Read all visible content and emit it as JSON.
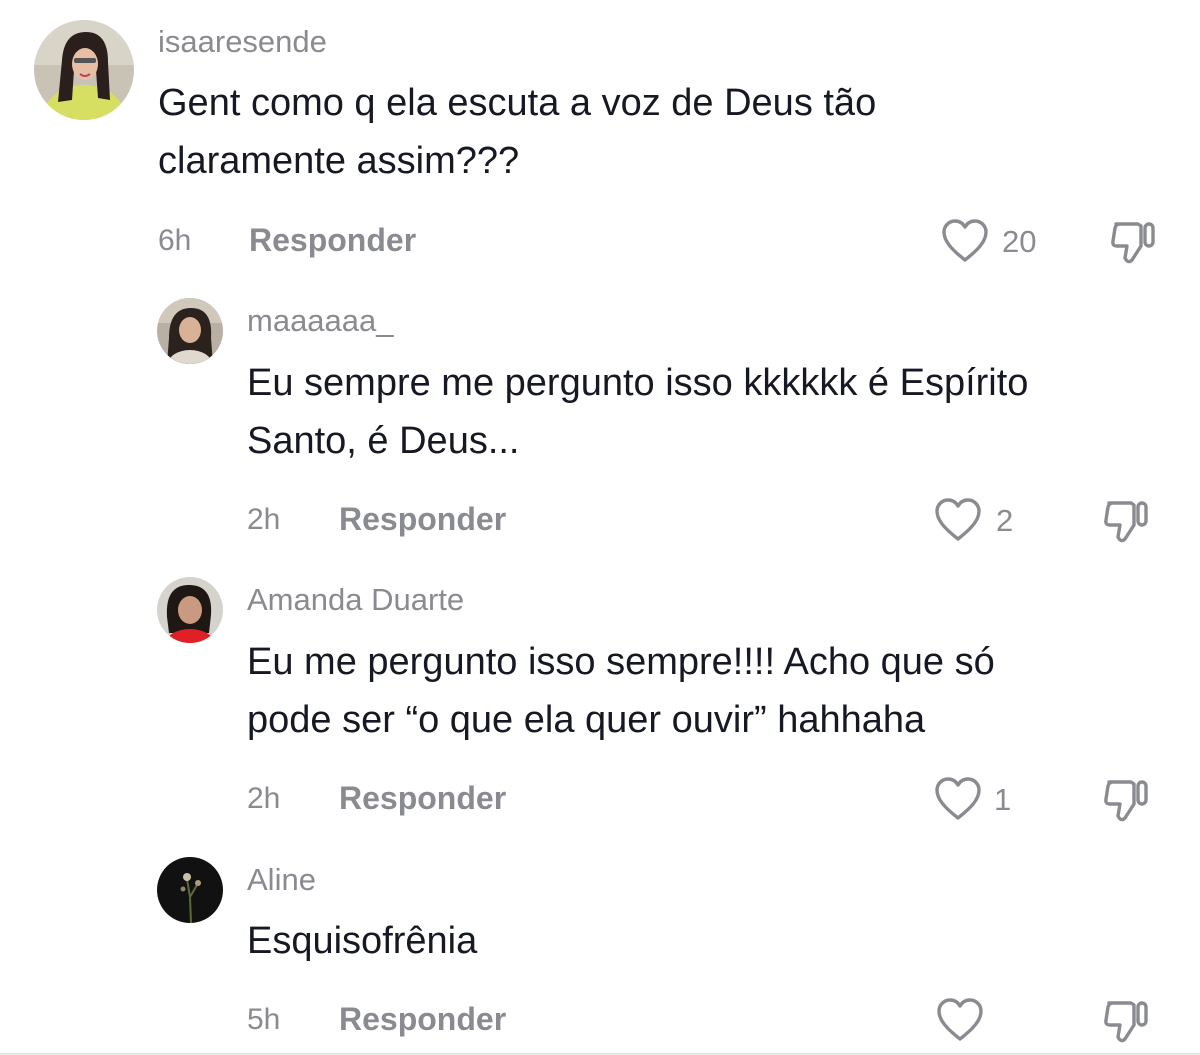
{
  "comments": [
    {
      "username": "isaaresende",
      "text_lines": [
        "Gent como q ela escuta a voz de Deus tão",
        "claramente assim???"
      ],
      "time": "6h",
      "reply_label": "Responder",
      "likes": "20",
      "avatar_icon": "user-avatar-photo"
    },
    {
      "username": "maaaaaa_",
      "text_lines": [
        "Eu sempre me pergunto isso kkkkkk é Espírito",
        "Santo, é Deus..."
      ],
      "time": "2h",
      "reply_label": "Responder",
      "likes": "2",
      "avatar_icon": "user-avatar-photo"
    },
    {
      "username": "Amanda Duarte",
      "text_lines": [
        "Eu me pergunto isso sempre!!!! Acho que só",
        "pode ser “o que ela quer ouvir” hahhaha"
      ],
      "time": "2h",
      "reply_label": "Responder",
      "likes": "1",
      "avatar_icon": "user-avatar-photo"
    },
    {
      "username": "Aline",
      "text_lines": [
        "Esquisofrênia"
      ],
      "time": "5h",
      "reply_label": "Responder",
      "likes": "",
      "avatar_icon": "user-avatar-photo"
    }
  ],
  "colors": {
    "text": "#161823",
    "muted": "#8a8b91",
    "background": "#ffffff"
  },
  "icons": {
    "like": "heart-outline-icon",
    "dislike": "thumbs-down-icon"
  }
}
